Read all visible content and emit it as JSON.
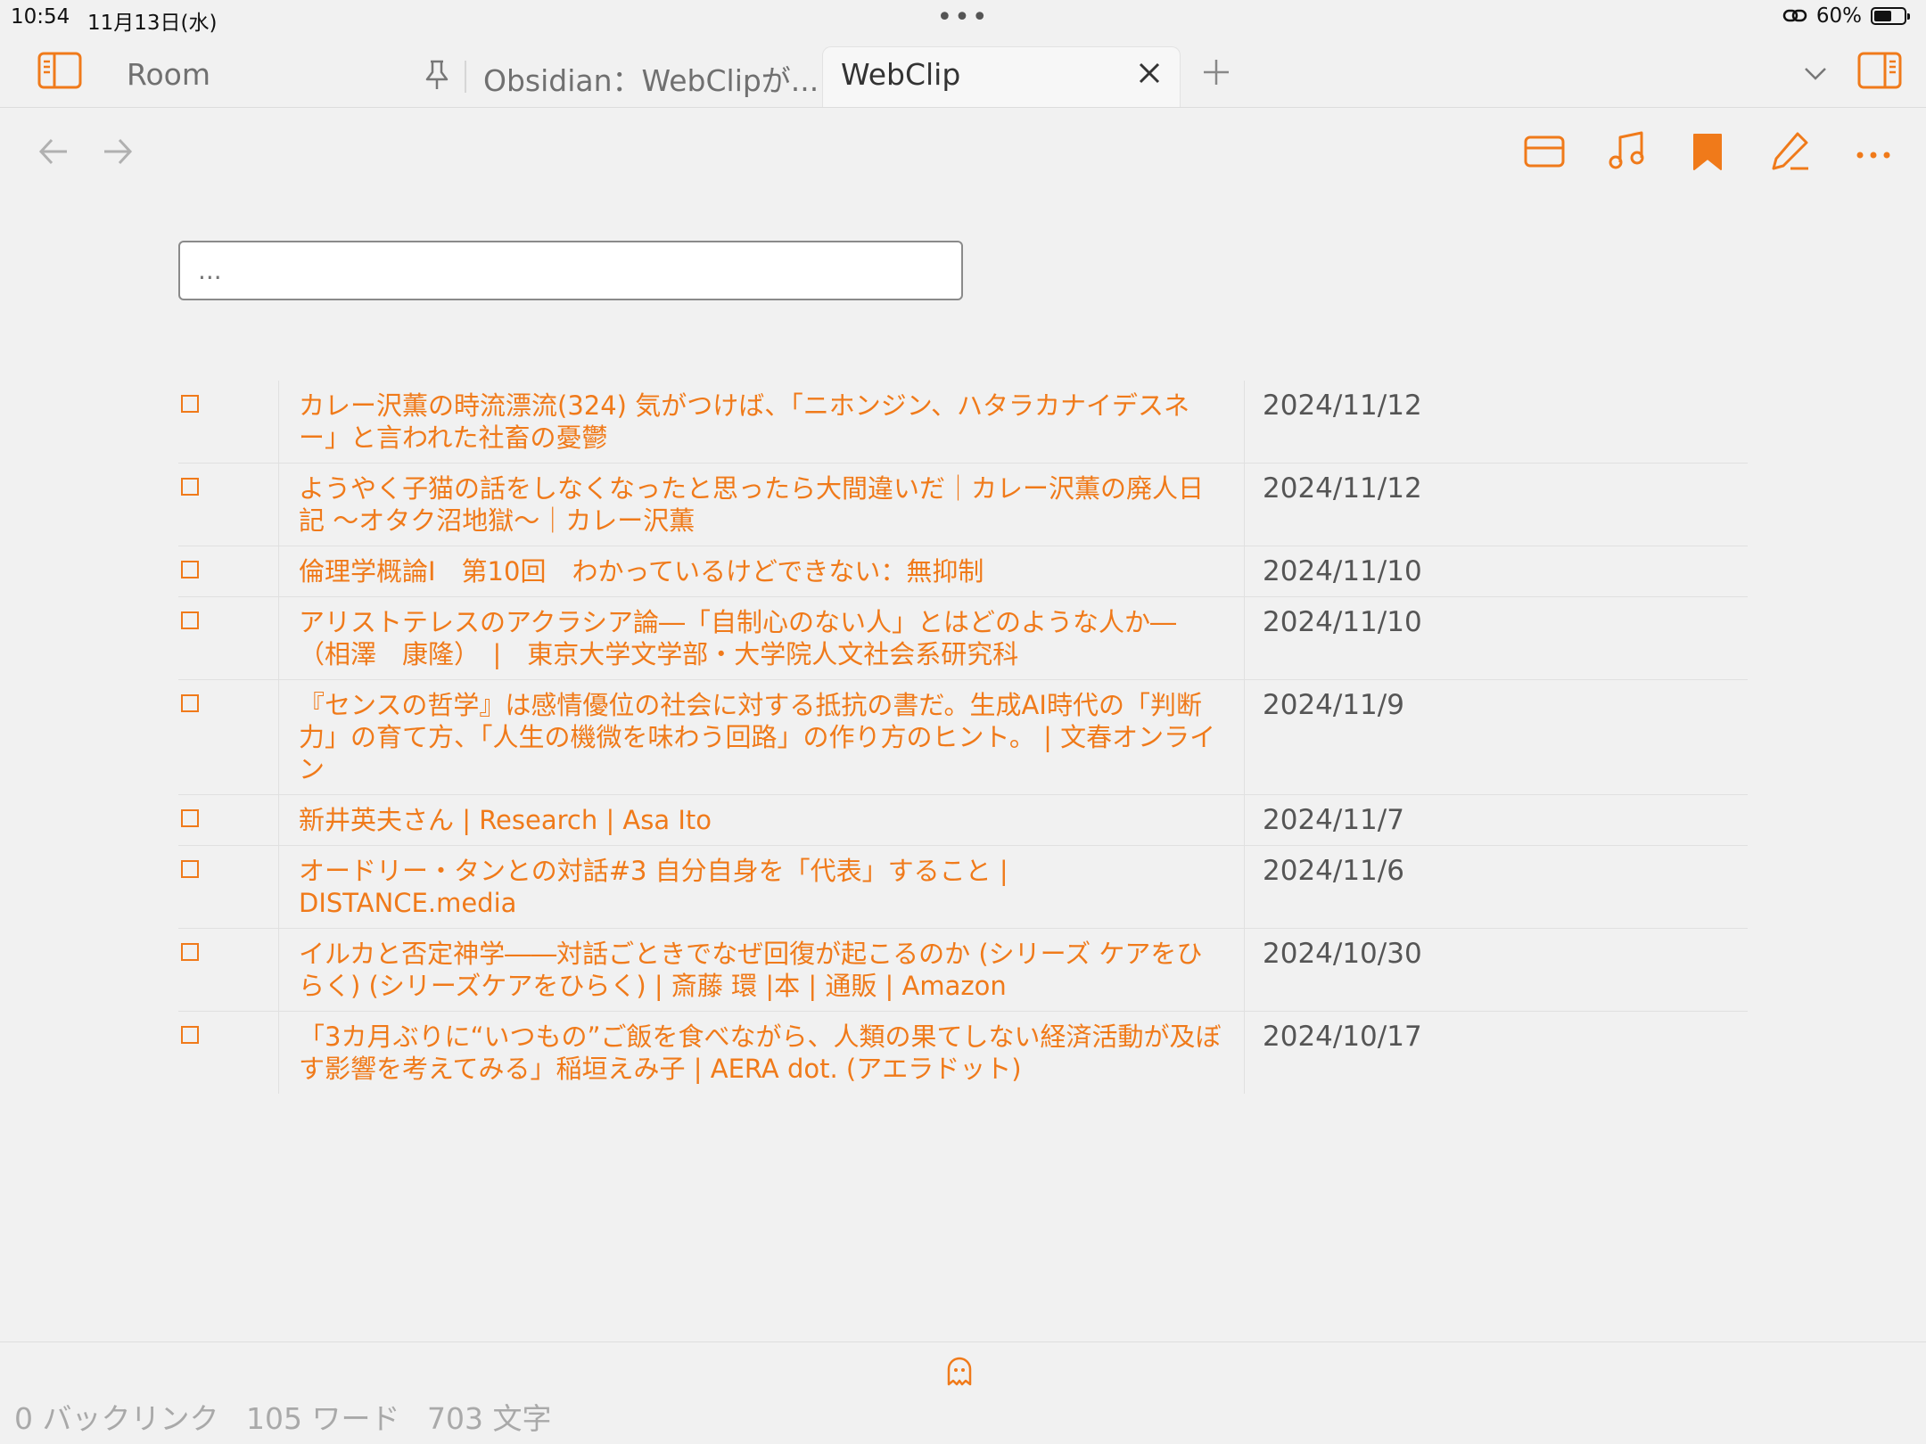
{
  "status_bar": {
    "time": "10:54",
    "date": "11月13日(水)",
    "dots": "•••",
    "battery_text": "60%",
    "battery_level": 0.6
  },
  "tabs": [
    {
      "label": "Room"
    },
    {
      "label": "Obsidian：WebClipが..."
    },
    {
      "label": "WebClip",
      "active": true
    }
  ],
  "search": {
    "placeholder": "..."
  },
  "rows": [
    {
      "title": "カレー沢薫の時流漂流(324) 気がつけば、「ニホンジン、ハタラカナイデスネー」と言われた社畜の憂鬱",
      "date": "2024/11/12"
    },
    {
      "title": "ようやく子猫の話をしなくなったと思ったら大間違いだ｜カレー沢薫の廃人日記 〜オタク沼地獄〜｜カレー沢薫",
      "date": "2024/11/12"
    },
    {
      "title": "倫理学概論Ⅰ　第10回　わかっているけどできない：無抑制",
      "date": "2024/11/10"
    },
    {
      "title": "アリストテレスのアクラシア論―「自制心のない人」とはどのような人か―（相澤　康隆）　|　東京大学文学部・大学院人文社会系研究科",
      "date": "2024/11/10"
    },
    {
      "title": "『センスの哲学』は感情優位の社会に対する抵抗の書だ。生成AI時代の「判断力」の育て方、「人生の機微を味わう回路」の作り方のヒント。 | 文春オンライン",
      "date": "2024/11/9"
    },
    {
      "title": "新井英夫さん | Research | Asa Ito",
      "date": "2024/11/7"
    },
    {
      "title": "オードリー・タンとの対話#3 自分自身を「代表」すること | DISTANCE.media",
      "date": "2024/11/6"
    },
    {
      "title": "イルカと否定神学――対話ごときでなぜ回復が起こるのか (シリーズ ケアをひらく) (シリーズケアをひらく) | 斎藤 環 |本 | 通販 | Amazon",
      "date": "2024/10/30"
    },
    {
      "title": "「3カ月ぶりに“いつもの”ご飯を食べながら、人類の果てしない経済活動が及ぼす影響を考えてみる」稲垣えみ子 | AERA dot. (アエラドット)",
      "date": "2024/10/17"
    }
  ],
  "footer": {
    "backlinks": "0 バックリンク",
    "words": "105 ワード",
    "chars": "703 文字"
  },
  "colors": {
    "accent": "#f07a1a",
    "background": "#f1f1f1"
  },
  "icons": [
    "sidebar-left-icon",
    "pin-icon",
    "close-icon",
    "plus-icon",
    "chevron-down-icon",
    "sidebar-right-icon",
    "back-arrow-icon",
    "forward-arrow-icon",
    "reading-view-icon",
    "music-note-icon",
    "bookmark-icon",
    "edit-pencil-icon",
    "more-options-icon",
    "ghost-icon",
    "link-icon",
    "battery-icon"
  ]
}
